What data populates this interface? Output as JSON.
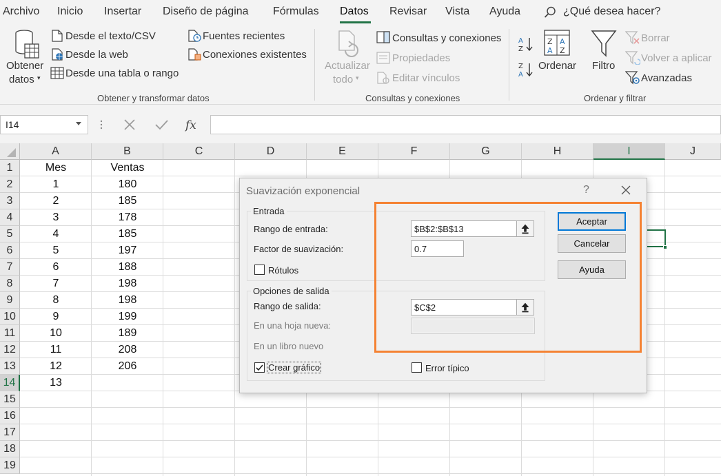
{
  "menubar": {
    "items": [
      "Archivo",
      "Inicio",
      "Insertar",
      "Diseño de página",
      "Fórmulas",
      "Datos",
      "Revisar",
      "Vista",
      "Ayuda"
    ],
    "active": "Datos",
    "search_placeholder": "¿Qué desea hacer?"
  },
  "ribbon": {
    "get_data": {
      "line1": "Obtener",
      "line2": "datos"
    },
    "from_text": "Desde el texto/CSV",
    "from_web": "Desde la web",
    "from_table": "Desde una tabla o rango",
    "recent_sources": "Fuentes recientes",
    "existing_connections": "Conexiones existentes",
    "group1_label": "Obtener y transformar datos",
    "refresh_all": {
      "line1": "Actualizar",
      "line2": "todo"
    },
    "queries_connections": "Consultas y conexiones",
    "properties": "Propiedades",
    "edit_links": "Editar vínculos",
    "group2_label": "Consultas y conexiones",
    "sort_label": "Ordenar",
    "filter_label": "Filtro",
    "clear": "Borrar",
    "reapply": "Volver a aplicar",
    "advanced": "Avanzadas",
    "group3_label": "Ordenar y filtrar"
  },
  "formula_bar": {
    "name_box": "I14",
    "formula": ""
  },
  "grid": {
    "columns": [
      "A",
      "B",
      "C",
      "D",
      "E",
      "F",
      "G",
      "H",
      "I",
      "J"
    ],
    "selected_column": "I",
    "rows": [
      "1",
      "2",
      "3",
      "4",
      "5",
      "6",
      "7",
      "8",
      "9",
      "10",
      "11",
      "12",
      "13",
      "14",
      "15",
      "16",
      "17",
      "18",
      "19"
    ],
    "selected_row": "14",
    "cells": {
      "A": [
        "Mes",
        "1",
        "2",
        "3",
        "4",
        "5",
        "6",
        "7",
        "8",
        "9",
        "10",
        "11",
        "12",
        "13"
      ],
      "B": [
        "Ventas",
        "180",
        "185",
        "178",
        "185",
        "197",
        "188",
        "198",
        "198",
        "199",
        "189",
        "208",
        "206"
      ]
    }
  },
  "dialog": {
    "title": "Suavización exponencial",
    "help": "?",
    "input_group": "Entrada",
    "input_range_label": "Rango de entrada:",
    "input_range_value": "$B$2:$B$13",
    "smoothing_label": "Factor de suavización:",
    "smoothing_value": "0.7",
    "labels_checkbox": "Rótulos",
    "labels_checked": false,
    "output_group": "Opciones de salida",
    "output_range_label": "Rango de salida:",
    "output_range_value": "$C$2",
    "new_sheet_label": "En una hoja nueva:",
    "new_book_label": "En un libro nuevo",
    "chart_checkbox": "Crear gráfico",
    "chart_checked": true,
    "stderr_checkbox": "Error típico",
    "stderr_checked": false,
    "ok_button": "Aceptar",
    "cancel_button": "Cancelar",
    "help_button": "Ayuda"
  },
  "colors": {
    "excel_green": "#217346",
    "highlight_orange": "#f58233",
    "focus_blue": "#0078d7"
  }
}
